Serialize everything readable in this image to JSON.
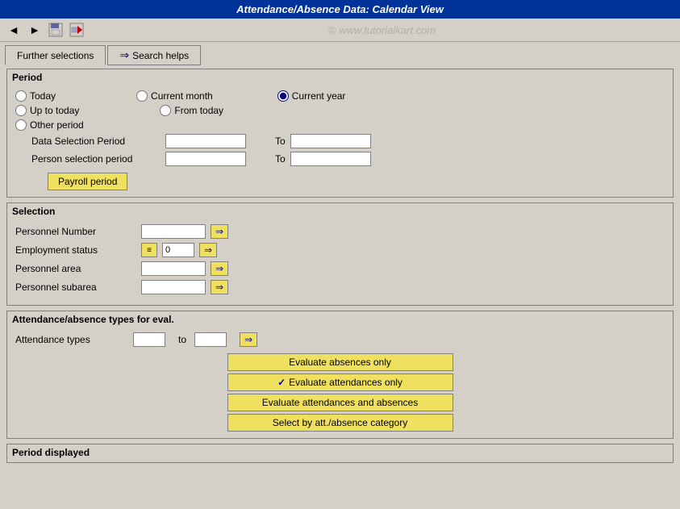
{
  "title": "Attendance/Absence Data: Calendar View",
  "toolbar": {
    "icons": [
      "back-icon",
      "forward-icon",
      "save-icon",
      "exit-icon"
    ]
  },
  "watermark": "© www.tutorialkart.com",
  "tabs": [
    {
      "label": "Further selections",
      "active": true
    },
    {
      "label": "Search helps",
      "active": false
    }
  ],
  "period_section": {
    "title": "Period",
    "radio_options": [
      {
        "label": "Today",
        "value": "today",
        "checked": false,
        "row": 1,
        "col": 1
      },
      {
        "label": "Current month",
        "value": "current_month",
        "checked": false,
        "row": 1,
        "col": 2
      },
      {
        "label": "Current year",
        "value": "current_year",
        "checked": true,
        "row": 1,
        "col": 3
      },
      {
        "label": "Up to today",
        "value": "up_to_today",
        "checked": false,
        "row": 2,
        "col": 1
      },
      {
        "label": "From today",
        "value": "from_today",
        "checked": false,
        "row": 2,
        "col": 2
      },
      {
        "label": "Other period",
        "value": "other_period",
        "checked": false,
        "row": 3,
        "col": 1
      }
    ],
    "data_selection_period": {
      "label": "Data Selection Period",
      "from_value": "",
      "to_label": "To",
      "to_value": ""
    },
    "person_selection_period": {
      "label": "Person selection period",
      "from_value": "",
      "to_label": "To",
      "to_value": ""
    },
    "payroll_btn_label": "Payroll period"
  },
  "selection_section": {
    "title": "Selection",
    "rows": [
      {
        "label": "Personnel Number",
        "value": "",
        "has_arrow": true
      },
      {
        "label": "Employment status",
        "value": "0",
        "has_status_icon": true,
        "has_arrow": true
      },
      {
        "label": "Personnel area",
        "value": "",
        "has_arrow": true
      },
      {
        "label": "Personnel subarea",
        "value": "",
        "has_arrow": true
      }
    ]
  },
  "attendance_section": {
    "title": "Attendance/absence types for eval.",
    "attendance_types_label": "Attendance types",
    "from_value": "",
    "to_label": "to",
    "to_value": "",
    "buttons": [
      {
        "label": "Evaluate absences only",
        "checked": false
      },
      {
        "label": "Evaluate attendances only",
        "checked": true
      },
      {
        "label": "Evaluate attendances and absences",
        "checked": false
      },
      {
        "label": "Select by att./absence category",
        "checked": false
      }
    ]
  },
  "period_displayed_section": {
    "title": "Period displayed"
  }
}
